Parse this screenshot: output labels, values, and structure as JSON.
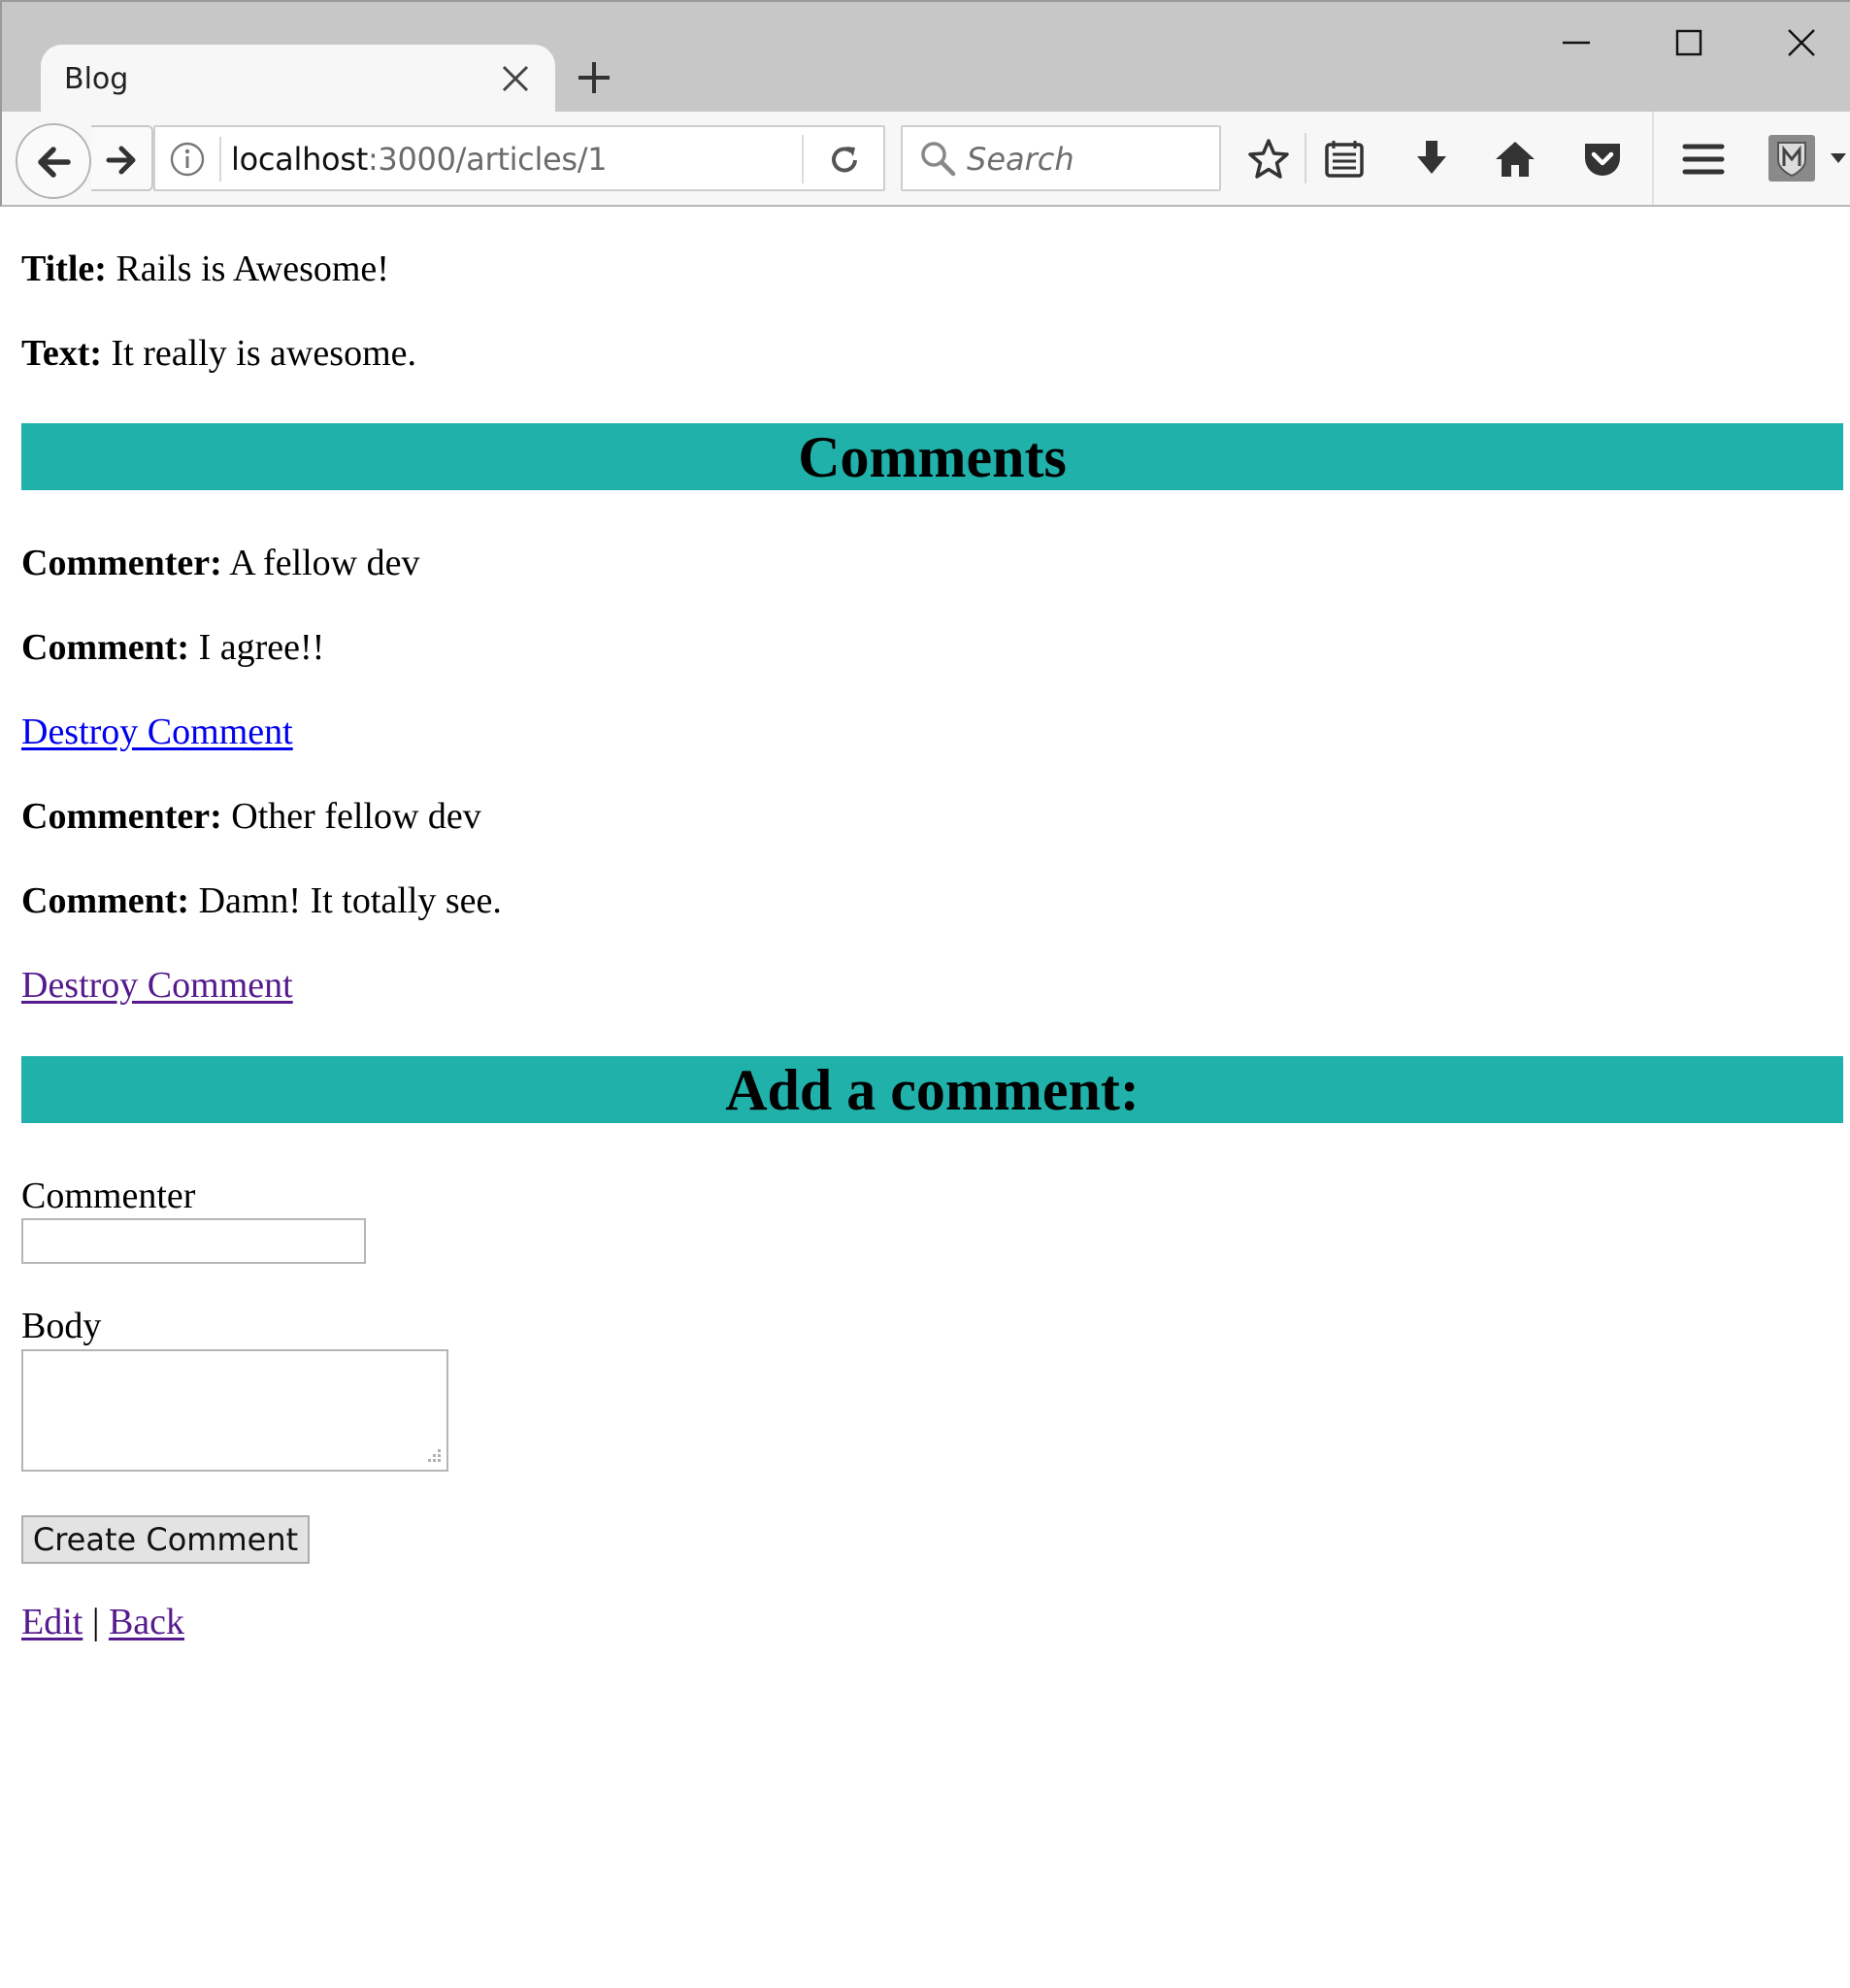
{
  "browser": {
    "tab_title": "Blog",
    "url_host": "localhost",
    "url_path": ":3000/articles/1",
    "search_placeholder": "Search"
  },
  "article": {
    "title_label": "Title:",
    "title_value": "Rails is Awesome!",
    "text_label": "Text:",
    "text_value": "It really is awesome."
  },
  "comments_heading": "Comments",
  "comments": [
    {
      "commenter_label": "Commenter:",
      "commenter": "A fellow dev",
      "comment_label": "Comment:",
      "body": "I agree!!",
      "destroy_label": "Destroy Comment"
    },
    {
      "commenter_label": "Commenter:",
      "commenter": "Other fellow dev",
      "comment_label": "Comment:",
      "body": "Damn! It totally see.",
      "destroy_label": "Destroy Comment"
    }
  ],
  "form": {
    "heading": "Add a comment:",
    "commenter_label": "Commenter",
    "commenter_value": "",
    "body_label": "Body",
    "body_value": "",
    "submit_label": "Create Comment"
  },
  "footer": {
    "edit_label": "Edit",
    "separator": "|",
    "back_label": "Back"
  },
  "colors": {
    "banner": "#20b2aa",
    "link": "#0000ee",
    "visited_link": "#551a8b"
  }
}
